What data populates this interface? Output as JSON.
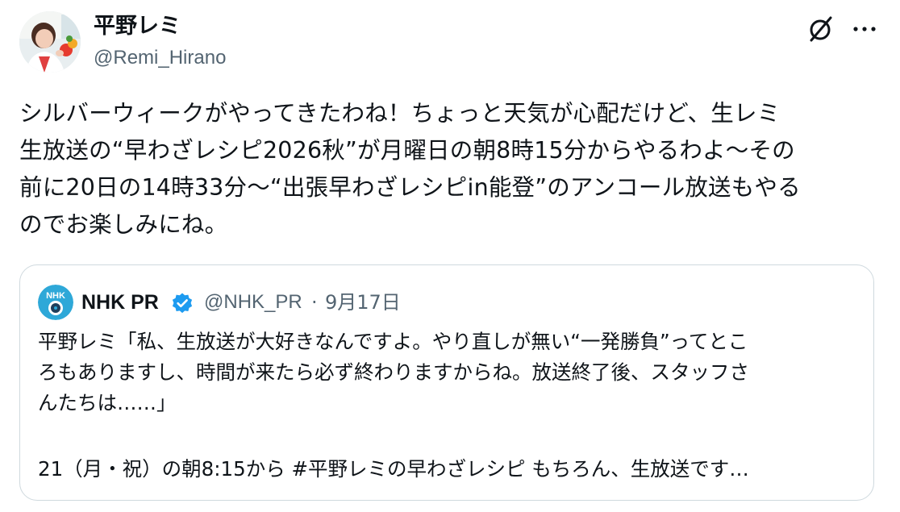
{
  "tweet": {
    "author_name": "平野レミ",
    "author_handle": "@Remi_Hirano",
    "text": "シルバーウィークがやってきたわね！ちょっと天気が心配だけど、生レミ\n生放送の“早わざレシピ2026秋”が月曜日の朝8時15分からやるわよ〜その\n前に20日の14時33分〜“出張早わざレシピin能登”のアンコール放送もやる\nのでお楽しみにね。"
  },
  "quote": {
    "author_name": "NHK PR",
    "author_handle": "@NHK_PR",
    "separator": "·",
    "date": "9月17日",
    "text": "平野レミ「私、生放送が大好きなんですよ。やり直しが無い“一発勝負”ってとこ\nろもありますし、時間が来たら必ず終わりますからね。放送終了後、スタッフさ\nんたちは……」",
    "text_line2": "21（月・祝）の朝8:15から #平野レミの早わざレシピ もちろん、生放送です…",
    "avatar_label": "NHK"
  },
  "icons": {
    "grok": "grok-icon",
    "more": "more-icon",
    "verified": "verified-badge-icon"
  },
  "colors": {
    "text": "#0f1419",
    "secondary": "#536471",
    "border": "#cfd9de",
    "verified": "#1d9bf0",
    "nhk_avatar": "#2ea8d8"
  }
}
